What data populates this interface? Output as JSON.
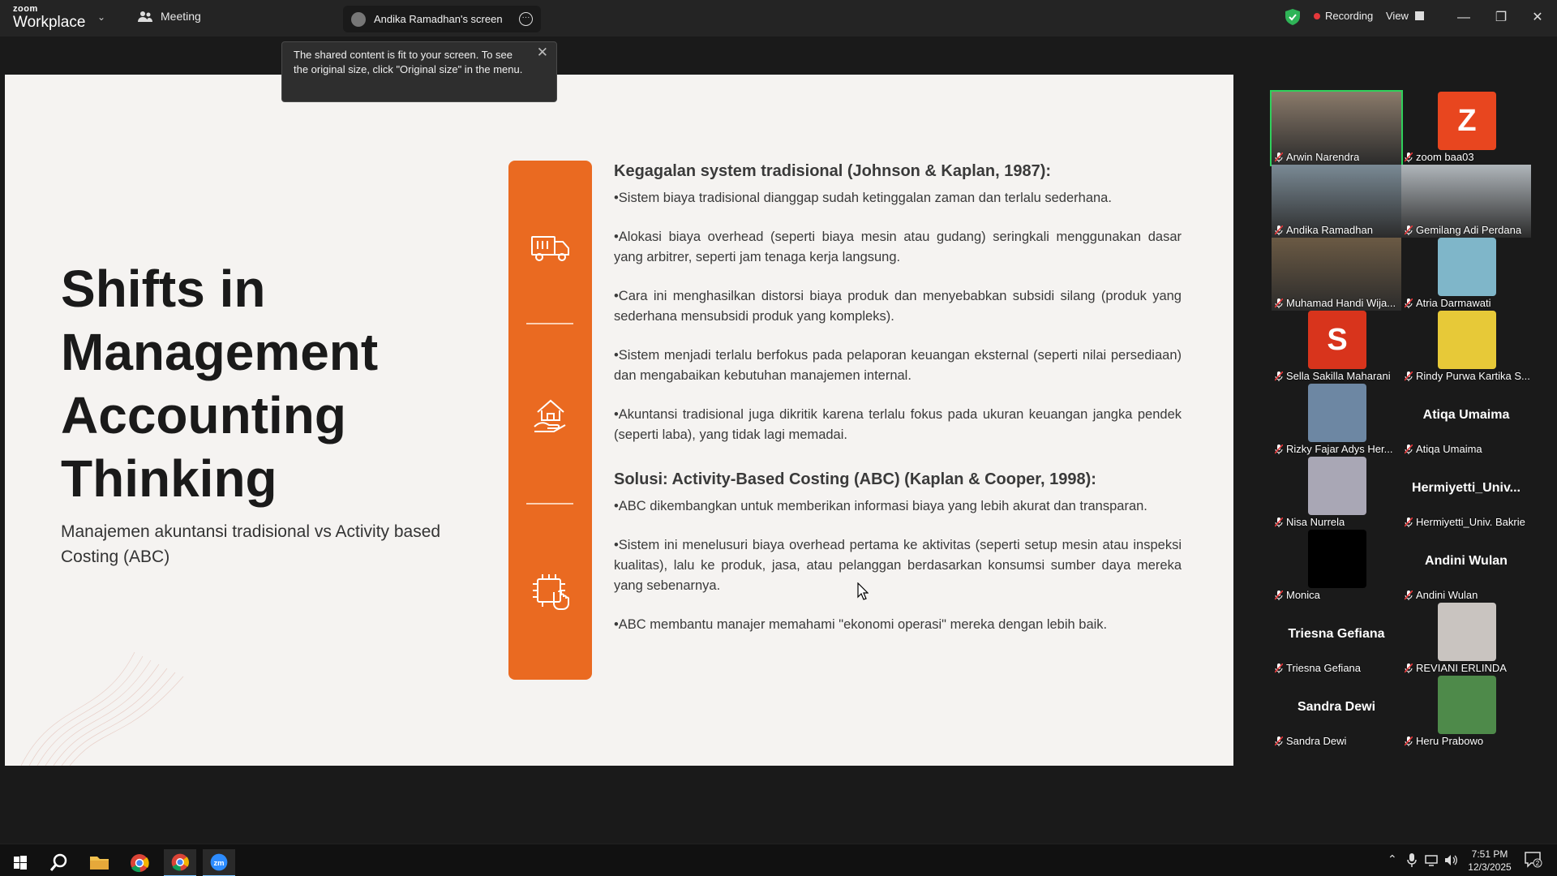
{
  "app": {
    "logo_small": "zoom",
    "logo_big": "Workplace",
    "meeting_label": "Meeting",
    "screen_tab": "Andika Ramadhan's screen",
    "recording_label": "Recording",
    "view_label": "View",
    "accent": "#2fd05b",
    "recording_color": "#e5383b"
  },
  "toast": {
    "text": "The shared content is fit to your screen. To see the original size, click \"Original size\" in the menu."
  },
  "slide": {
    "title": "Shifts in Management Accounting Thinking",
    "subtitle": "Manajemen akuntansi tradisional vs Activity based Costing (ABC)",
    "accent": "#ea6a21",
    "section1": {
      "heading": "Kegagalan system tradisional (Johnson & Kaplan, 1987):",
      "bullets": [
        "•Sistem biaya tradisional dianggap sudah ketinggalan zaman dan terlalu sederhana.",
        "•Alokasi biaya overhead (seperti biaya mesin atau gudang) seringkali menggunakan dasar yang arbitrer, seperti jam tenaga kerja langsung.",
        "•Cara ini menghasilkan distorsi biaya produk dan menyebabkan subsidi silang (produk yang sederhana mensubsidi produk yang kompleks).",
        "•Sistem menjadi terlalu berfokus pada pelaporan keuangan eksternal (seperti nilai persediaan) dan mengabaikan kebutuhan manajemen internal.",
        "•Akuntansi tradisional juga dikritik karena terlalu fokus pada ukuran keuangan jangka pendek (seperti laba), yang tidak lagi memadai."
      ]
    },
    "section2": {
      "heading": "Solusi: Activity-Based Costing (ABC) (Kaplan & Cooper, 1998):",
      "bullets": [
        "•ABC dikembangkan untuk memberikan informasi biaya yang lebih akurat dan transparan.",
        "•Sistem ini menelusuri biaya overhead pertama ke aktivitas (seperti setup mesin atau inspeksi kualitas), lalu ke produk, jasa, atau pelanggan berdasarkan konsumsi sumber daya mereka yang sebenarnya.",
        "•ABC membantu manajer memahami \"ekonomi operasi\" mereka dengan lebih baik."
      ]
    }
  },
  "participants": [
    {
      "name": "Arwin Narendra",
      "kind": "video",
      "color": "#8a7a6a"
    },
    {
      "name": "zoom baa03",
      "kind": "letter",
      "letter": "Z",
      "color": "#e8461f"
    },
    {
      "name": "Andika Ramadhan",
      "kind": "video",
      "color": "#7a8a95"
    },
    {
      "name": "Gemilang Adi Perdana",
      "kind": "video",
      "color": "#b0b6bb"
    },
    {
      "name": "Muhamad Handi Wija...",
      "kind": "video",
      "color": "#6b5a44"
    },
    {
      "name": "Atria Darmawati",
      "kind": "pic",
      "color": "#7fb6c9"
    },
    {
      "name": "Sella Sakilla Maharani",
      "kind": "letter",
      "letter": "S",
      "color": "#d8341c"
    },
    {
      "name": "Rindy Purwa Kartika S...",
      "kind": "pic",
      "color": "#e7c938"
    },
    {
      "name": "Rizky Fajar Adys Her...",
      "kind": "pic",
      "color": "#6d87a3"
    },
    {
      "name": "Atiqa Umaima",
      "kind": "name",
      "big": "Atiqa Umaima"
    },
    {
      "name": "Nisa Nurrela",
      "kind": "pic",
      "color": "#a9a7b5"
    },
    {
      "name": "Hermiyetti_Univ. Bakrie",
      "kind": "name",
      "big": "Hermiyetti_Univ..."
    },
    {
      "name": "Monica",
      "kind": "pic",
      "color": "#000000"
    },
    {
      "name": "Andini Wulan",
      "kind": "name",
      "big": "Andini Wulan"
    },
    {
      "name": "Triesna Gefiana",
      "kind": "name",
      "big": "Triesna Gefiana"
    },
    {
      "name": "REVIANI ERLINDA",
      "kind": "pic",
      "color": "#c9c4c0"
    },
    {
      "name": "Sandra Dewi",
      "kind": "name",
      "big": "Sandra Dewi"
    },
    {
      "name": "Heru Prabowo",
      "kind": "pic",
      "color": "#4e8a4a"
    }
  ],
  "taskbar": {
    "time": "7:51 PM",
    "date": "12/3/2025",
    "notif_count": "2"
  }
}
